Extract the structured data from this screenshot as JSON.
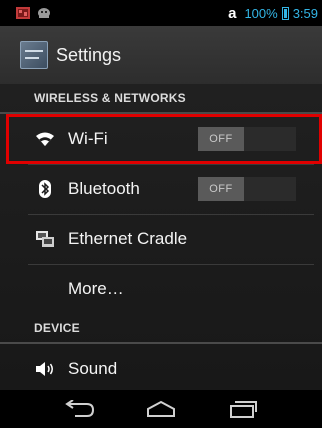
{
  "status_bar": {
    "carrier_glyph": "a",
    "battery_percent": "100%",
    "time": "3:59",
    "icons": [
      "gallery-notification-icon",
      "android-notification-icon",
      "battery-icon"
    ]
  },
  "action_bar": {
    "title": "Settings",
    "icon": "settings-app-icon"
  },
  "sections": [
    {
      "header": "WIRELESS & NETWORKS",
      "items": [
        {
          "label": "Wi-Fi",
          "icon": "wifi-icon",
          "toggle": "OFF",
          "highlighted": true
        },
        {
          "label": "Bluetooth",
          "icon": "bluetooth-icon",
          "toggle": "OFF"
        },
        {
          "label": "Ethernet Cradle",
          "icon": "ethernet-icon"
        },
        {
          "label": "More…"
        }
      ]
    },
    {
      "header": "DEVICE",
      "items": [
        {
          "label": "Sound",
          "icon": "speaker-icon"
        }
      ]
    }
  ],
  "nav_bar": {
    "icons": [
      "back-icon",
      "home-icon",
      "recent-apps-icon"
    ]
  },
  "colors": {
    "accent": "#33b5e5",
    "highlight_outline": "#e00000",
    "background": "#1c1c1c"
  }
}
